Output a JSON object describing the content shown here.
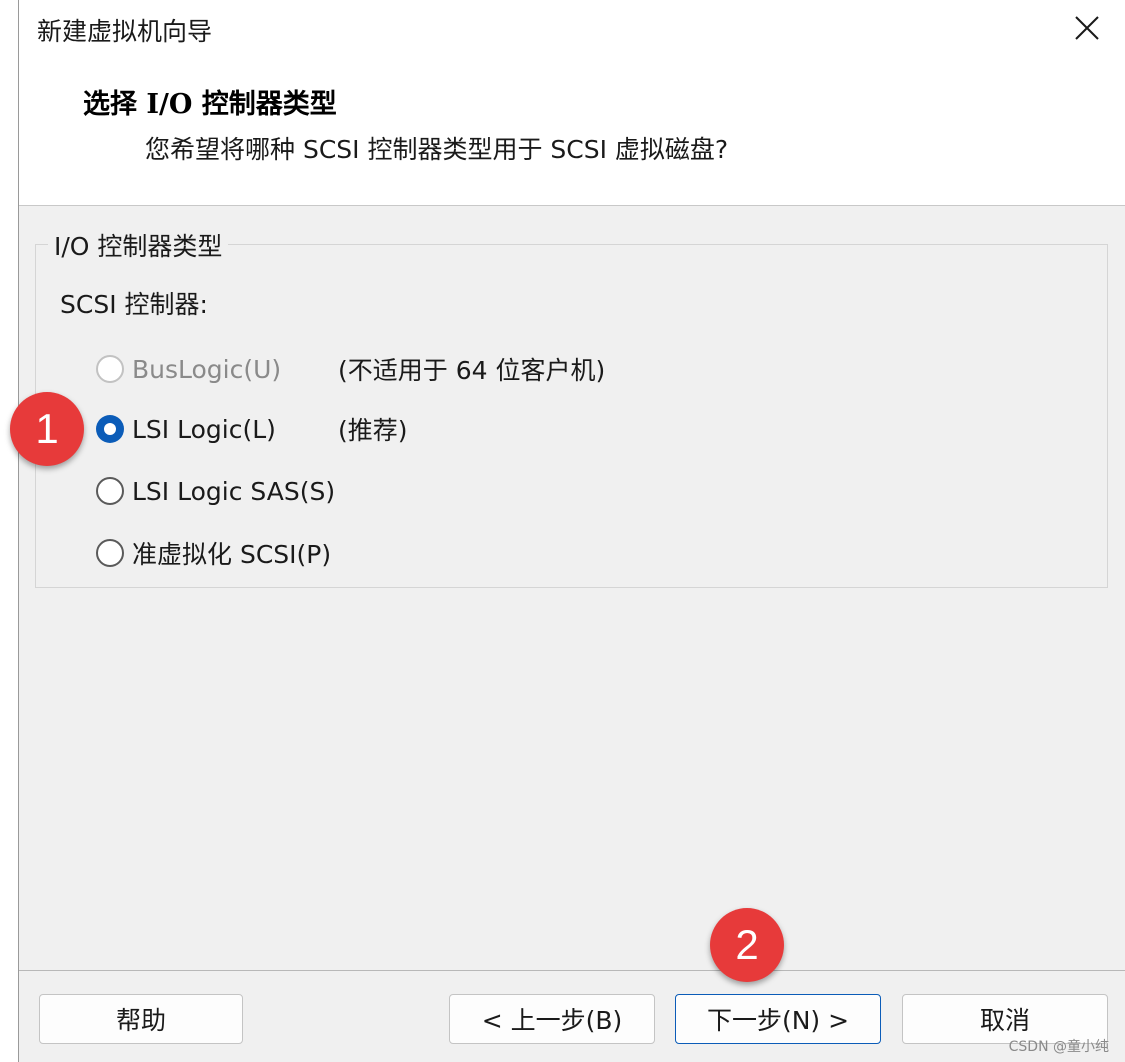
{
  "window": {
    "title": "新建虚拟机向导",
    "close_icon": "close-icon"
  },
  "header": {
    "title": "选择 I/O 控制器类型",
    "subtitle": "您希望将哪种 SCSI 控制器类型用于 SCSI 虚拟磁盘?"
  },
  "group": {
    "legend": "I/O 控制器类型",
    "label": "SCSI 控制器:",
    "options": [
      {
        "label": "BusLogic(U)",
        "note": "(不适用于 64 位客户机)",
        "state": "disabled"
      },
      {
        "label": "LSI Logic(L)",
        "note": "(推荐)",
        "state": "checked"
      },
      {
        "label": "LSI Logic SAS(S)",
        "note": "",
        "state": "unchecked"
      },
      {
        "label": "准虚拟化 SCSI(P)",
        "note": "",
        "state": "unchecked"
      }
    ]
  },
  "buttons": {
    "help": "帮助",
    "back": "< 上一步(B)",
    "next": "下一步(N) >",
    "cancel": "取消"
  },
  "badges": {
    "one": "1",
    "two": "2"
  },
  "watermark": "CSDN @童小纯",
  "colors": {
    "accent": "#0b5cb8",
    "badge": "#e73a3a"
  }
}
